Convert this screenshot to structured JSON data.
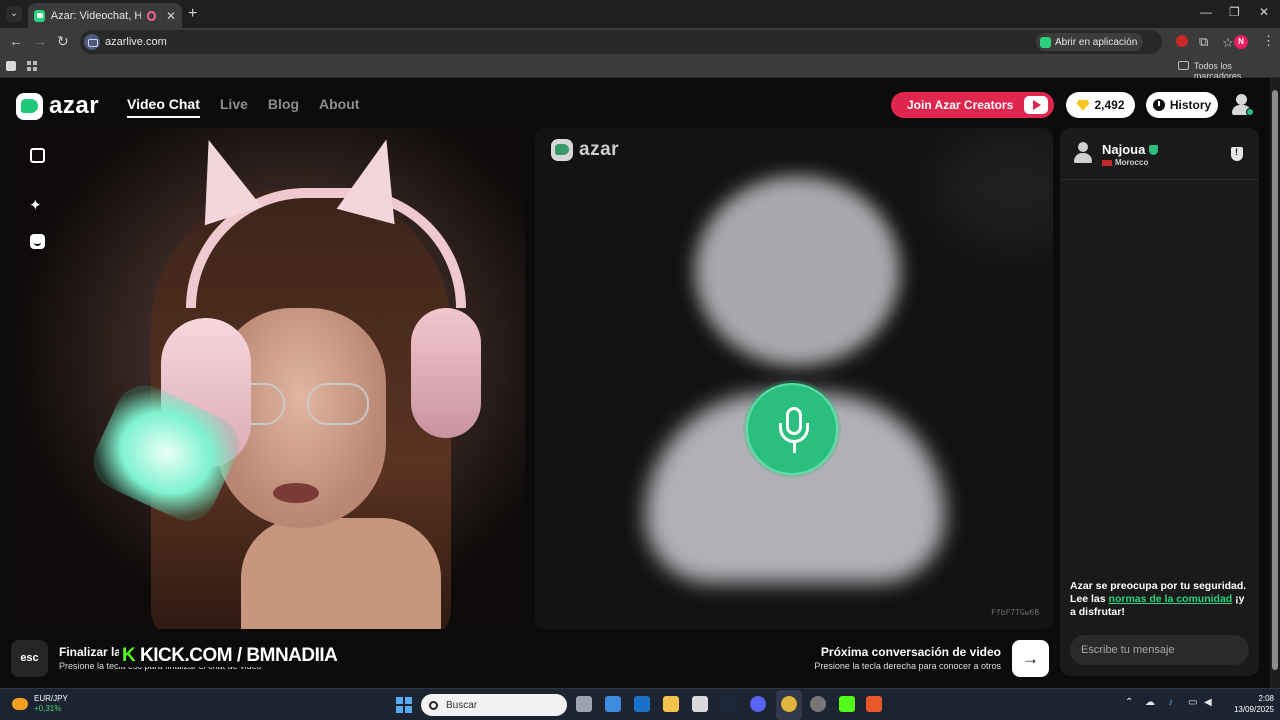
{
  "browser": {
    "tab_title": "Azar: Videochat, Haz nuevo",
    "url": "azarlive.com",
    "open_app_label": "Abrir en aplicación",
    "bookmarks_all": "Todos los marcadores",
    "profile_initial": "N"
  },
  "site": {
    "logo_text": "azar",
    "nav": [
      {
        "label": "Video Chat",
        "active": true
      },
      {
        "label": "Live",
        "active": false
      },
      {
        "label": "Blog",
        "active": false
      },
      {
        "label": "About",
        "active": false
      }
    ],
    "join_creators_label": "Join Azar Creators",
    "gems_count": "2,492",
    "history_label": "History",
    "accent_color": "#2bbf7f",
    "brand_red": "#e0264f"
  },
  "remote": {
    "logo_text": "azar",
    "session_code": "FfbF7TGw6B"
  },
  "controls": {
    "esc_key": "esc",
    "end_title": "Finalizar la",
    "end_sub": "Presione la tecla esc para finalizar el chat de video",
    "overlay_k": "K",
    "overlay_text": "KICK.COM / BMNADIIA",
    "next_title": "Próxima conversación de video",
    "next_sub": "Presione la tecla derecha para conocer a otros",
    "next_arrow": "→"
  },
  "chat": {
    "partner_name": "Najoua",
    "partner_country": "Morocco",
    "safety_text_1": "Azar se preocupa por tu seguridad. Lee las ",
    "safety_link": "normas de la comunidad",
    "safety_text_2": " ¡y a disfrutar!",
    "input_placeholder": "Escribe tu mensaje"
  },
  "taskbar": {
    "widget_pair": "EUR/JPY",
    "widget_change": "+0,31%",
    "search_placeholder": "Buscar",
    "time": "2:08",
    "date": "13/09/2025"
  }
}
